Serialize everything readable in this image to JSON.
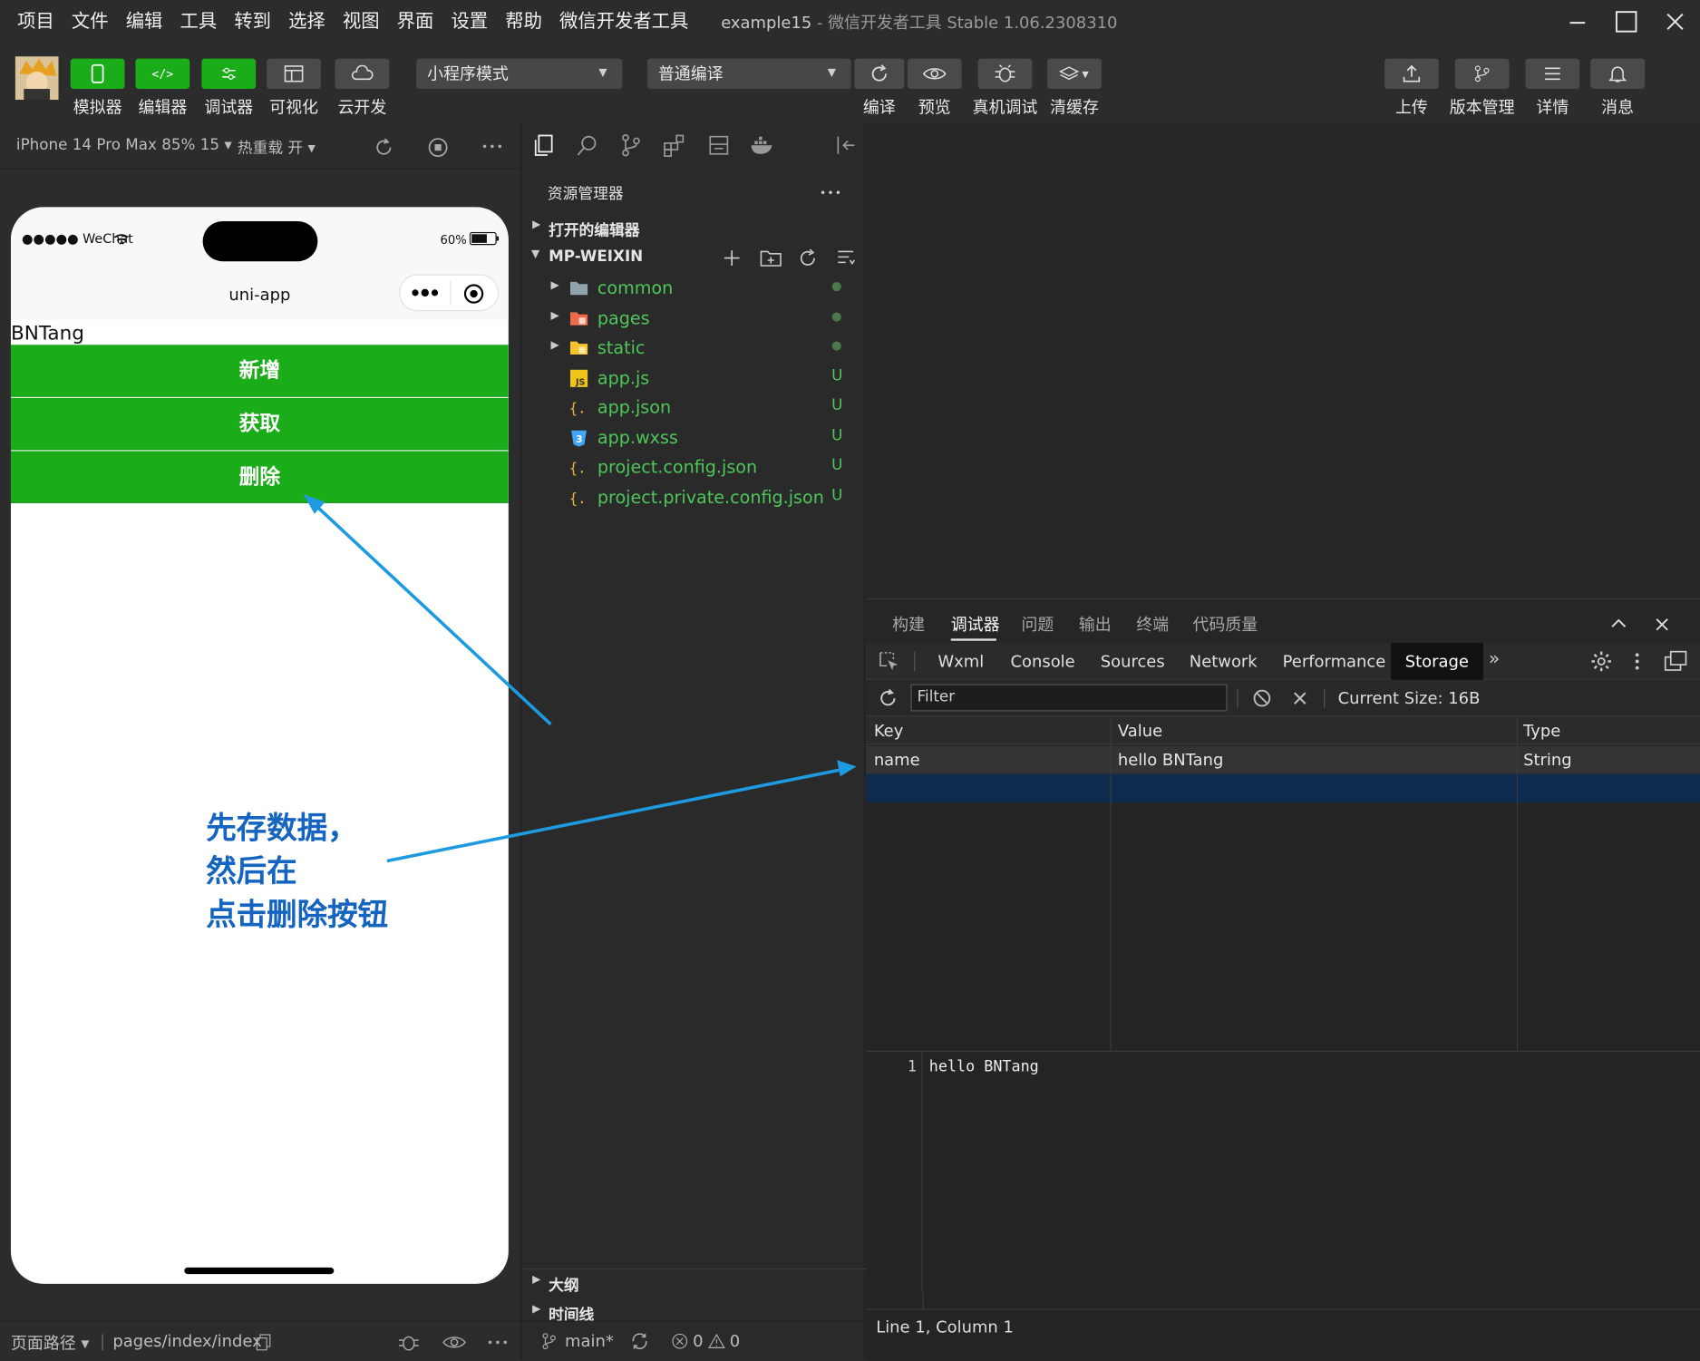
{
  "menu": [
    "项目",
    "文件",
    "编辑",
    "工具",
    "转到",
    "选择",
    "视图",
    "界面",
    "设置",
    "帮助",
    "微信开发者工具"
  ],
  "window": {
    "project": "example15",
    "app_title": "微信开发者工具 Stable 1.06.2308310"
  },
  "toolbar": {
    "simulator": "模拟器",
    "editor": "编辑器",
    "debugger": "调试器",
    "visual": "可视化",
    "cloud": "云开发",
    "mode_select": "小程序模式",
    "compile_select": "普通编译",
    "compile": "编译",
    "preview": "预览",
    "remote_debug": "真机调试",
    "clear_cache": "清缓存",
    "upload": "上传",
    "version": "版本管理",
    "details": "详情",
    "messages": "消息",
    "accent": "#1aad19"
  },
  "simbar": {
    "device": "iPhone 14 Pro Max 85% 15 ▾",
    "hot_reload": "热重载 开 ▾"
  },
  "phone": {
    "carrier": "●●●●● WeChat",
    "battery": "60%",
    "nav_title": "uni-app",
    "page_text": "BNTang",
    "buttons": [
      "新增",
      "获取",
      "删除"
    ]
  },
  "annotation": [
    "先存数据，",
    "然后在",
    "点击删除按钮"
  ],
  "explorer": {
    "title": "资源管理器",
    "open_editors": "打开的编辑器",
    "root": "MP-WEIXIN",
    "items": [
      {
        "name": "common",
        "status": "●",
        "type": "folder"
      },
      {
        "name": "pages",
        "status": "●",
        "type": "folder-pages"
      },
      {
        "name": "static",
        "status": "●",
        "type": "folder-static"
      },
      {
        "name": "app.js",
        "status": "U",
        "type": "js"
      },
      {
        "name": "app.json",
        "status": "U",
        "type": "json"
      },
      {
        "name": "app.wxss",
        "status": "U",
        "type": "css"
      },
      {
        "name": "project.config.json",
        "status": "U",
        "type": "json"
      },
      {
        "name": "project.private.config.json",
        "status": "U",
        "type": "json"
      }
    ],
    "outline": "大纲",
    "timeline": "时间线"
  },
  "left_status": {
    "route_label": "页面路径 ▾",
    "route": "pages/index/index"
  },
  "explorer_status": {
    "branch": "main*",
    "errors": "0",
    "warnings": "0"
  },
  "panel": {
    "tabs": [
      "构建",
      "调试器",
      "问题",
      "输出",
      "终端",
      "代码质量"
    ],
    "active_tab": "调试器",
    "devtools_tabs": [
      "Wxml",
      "Console",
      "Sources",
      "Network",
      "Performance",
      "Storage"
    ],
    "active_devtools": "Storage",
    "filter_placeholder": "Filter",
    "current_size": "Current Size: 16B",
    "columns": [
      "Key",
      "Value",
      "Type"
    ],
    "rows": [
      {
        "key": "name",
        "value": "hello BNTang",
        "type": "String"
      }
    ],
    "preview_line_no": "1",
    "preview_text": "hello BNTang",
    "cursor": "Line 1, Column 1"
  }
}
